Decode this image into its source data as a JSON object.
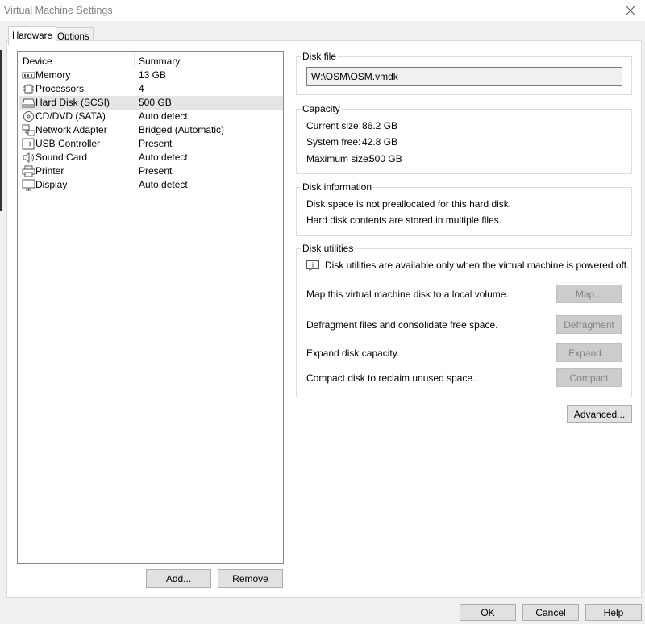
{
  "window": {
    "title": "Virtual Machine Settings"
  },
  "tabs": [
    {
      "label": "Hardware"
    },
    {
      "label": "Options"
    }
  ],
  "device_list": {
    "columns": {
      "device": "Device",
      "summary": "Summary"
    },
    "rows": [
      {
        "icon": "memory-icon",
        "name": "Memory",
        "summary": "13 GB"
      },
      {
        "icon": "processor-icon",
        "name": "Processors",
        "summary": "4"
      },
      {
        "icon": "hard-disk-icon",
        "name": "Hard Disk (SCSI)",
        "summary": "500 GB"
      },
      {
        "icon": "cd-dvd-icon",
        "name": "CD/DVD (SATA)",
        "summary": "Auto detect"
      },
      {
        "icon": "network-adapter-icon",
        "name": "Network Adapter",
        "summary": "Bridged (Automatic)"
      },
      {
        "icon": "usb-controller-icon",
        "name": "USB Controller",
        "summary": "Present"
      },
      {
        "icon": "sound-card-icon",
        "name": "Sound Card",
        "summary": "Auto detect"
      },
      {
        "icon": "printer-icon",
        "name": "Printer",
        "summary": "Present"
      },
      {
        "icon": "display-icon",
        "name": "Display",
        "summary": "Auto detect"
      }
    ],
    "add_label": "Add...",
    "remove_label": "Remove"
  },
  "disk_file": {
    "title": "Disk file",
    "path": "W:\\OSM\\OSM.vmdk"
  },
  "capacity": {
    "title": "Capacity",
    "current_label": "Current size:",
    "current_value": "86.2 GB",
    "free_label": "System free:",
    "free_value": "42.8 GB",
    "max_label": "Maximum size:",
    "max_value": "500 GB"
  },
  "disk_info": {
    "title": "Disk information",
    "line1": "Disk space is not preallocated for this hard disk.",
    "line2": "Hard disk contents are stored in multiple files."
  },
  "disk_utilities": {
    "title": "Disk utilities",
    "notice": "Disk utilities are available only when the virtual machine is powered off.",
    "map_desc": "Map this virtual machine disk to a local volume.",
    "map_label": "Map...",
    "defrag_desc": "Defragment files and consolidate free space.",
    "defrag_label": "Defragment",
    "expand_desc": "Expand disk capacity.",
    "expand_label": "Expand...",
    "compact_desc": "Compact disk to reclaim unused space.",
    "compact_label": "Compact"
  },
  "advanced_label": "Advanced...",
  "footer": {
    "ok_label": "OK",
    "cancel_label": "Cancel",
    "help_label": "Help"
  },
  "colors": {
    "selection": "#e5e5e5",
    "disabled_button": "#cccccc",
    "panel_border": "#dcdcdc"
  }
}
